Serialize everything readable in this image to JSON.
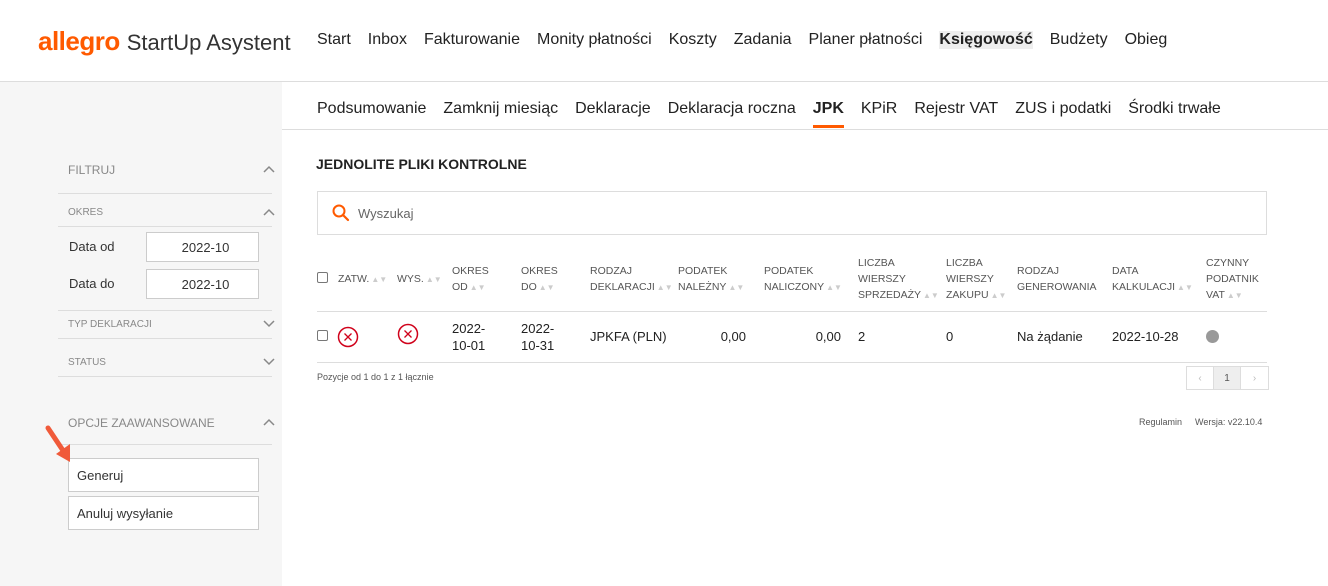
{
  "logo": {
    "brand": "allegro",
    "app": "StartUp Asystent"
  },
  "main_nav": [
    "Start",
    "Inbox",
    "Fakturowanie",
    "Monity płatności",
    "Koszty",
    "Zadania",
    "Planer płatności",
    "Księgowość",
    "Budżety",
    "Obieg"
  ],
  "main_nav_active": "Księgowość",
  "sub_nav": [
    "Podsumowanie",
    "Zamknij miesiąc",
    "Deklaracje",
    "Deklaracja roczna",
    "JPK",
    "KPiR",
    "Rejestr VAT",
    "ZUS i podatki",
    "Środki trwałe"
  ],
  "sub_nav_active": "JPK",
  "sidebar": {
    "filter_title": "FILTRUJ",
    "period_title": "OKRES",
    "date_from_label": "Data od",
    "date_from_value": "2022-10",
    "date_to_label": "Data do",
    "date_to_value": "2022-10",
    "type_title": "TYP DEKLARACJI",
    "status_title": "STATUS",
    "advanced_title": "OPCJE ZAAWANSOWANE",
    "generate_button": "Generuj",
    "cancel_send_button": "Anuluj wysyłanie"
  },
  "page_title": "JEDNOLITE PLIKI KONTROLNE",
  "search": {
    "placeholder": "Wyszukaj"
  },
  "table": {
    "headers": {
      "approved": "ZATW.",
      "sent": "WYS.",
      "period_from": [
        "OKRES",
        "OD"
      ],
      "period_to": [
        "OKRES",
        "DO"
      ],
      "decl_type": [
        "RODZAJ",
        "DEKLARACJI"
      ],
      "tax_due": [
        "PODATEK",
        "NALEŻNY"
      ],
      "tax_input": [
        "PODATEK",
        "NALICZONY"
      ],
      "sales_rows": [
        "LICZBA",
        "WIERSZY",
        "SPRZEDAŻY"
      ],
      "purchase_rows": [
        "LICZBA",
        "WIERSZY",
        "ZAKUPU"
      ],
      "gen_type": [
        "RODZAJ",
        "GENEROWANIA"
      ],
      "calc_date": [
        "DATA",
        "KALKULACJI"
      ],
      "active_vat": [
        "CZYNNY",
        "PODATNIK",
        "VAT"
      ]
    },
    "rows": [
      {
        "period_from": [
          "2022-",
          "10-01"
        ],
        "period_to": [
          "2022-",
          "10-31"
        ],
        "decl_type": "JPKFA (PLN)",
        "tax_due": "0,00",
        "tax_input": "0,00",
        "sales_rows": "2",
        "purchase_rows": "0",
        "gen_type": "Na żądanie",
        "calc_date": "2022-10-28"
      }
    ]
  },
  "pagination": {
    "info": "Pozycje od 1 do 1 z 1 łącznie",
    "prev": "‹",
    "current": "1",
    "next": "›"
  },
  "footer": {
    "terms": "Regulamin",
    "version": "Wersja: v22.10.4"
  },
  "colors": {
    "accent": "#ff5a00",
    "error": "#d0021b",
    "arrow": "#f05a3a"
  }
}
